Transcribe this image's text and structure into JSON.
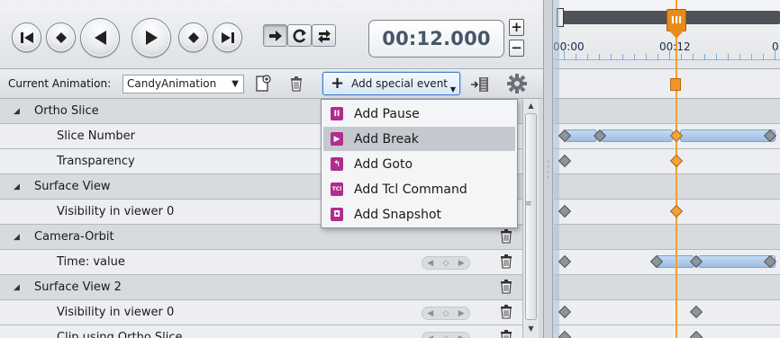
{
  "player": {
    "time_display": "00:12.000",
    "plus_label": "+",
    "minus_label": "−"
  },
  "animation_bar": {
    "current_label": "Current Animation:",
    "current_value": "CandyAnimation",
    "add_special_label": "Add special event"
  },
  "menu": {
    "items": [
      {
        "label": "Add Pause",
        "icon": "pause-event-icon",
        "glyph": "II"
      },
      {
        "label": "Add Break",
        "icon": "break-event-icon",
        "glyph": "▶"
      },
      {
        "label": "Add Goto",
        "icon": "goto-event-icon",
        "glyph": "↰"
      },
      {
        "label": "Add Tcl Command",
        "icon": "tcl-event-icon",
        "glyph": "TCl"
      },
      {
        "label": "Add Snapshot",
        "icon": "snapshot-event-icon",
        "glyph": "◘"
      }
    ],
    "highlighted": "Add Break"
  },
  "tree": {
    "rows": [
      {
        "type": "group",
        "label": "Ortho Slice"
      },
      {
        "type": "item",
        "label": "Slice Number"
      },
      {
        "type": "item",
        "label": "Transparency"
      },
      {
        "type": "group",
        "label": "Surface View"
      },
      {
        "type": "item",
        "label": "Visibility in viewer 0"
      },
      {
        "type": "group",
        "label": "Camera-Orbit"
      },
      {
        "type": "item",
        "label": "Time: value"
      },
      {
        "type": "group",
        "label": "Surface View 2"
      },
      {
        "type": "item",
        "label": "Visibility in viewer 0"
      },
      {
        "type": "item",
        "label": "Clip using Ortho Slice"
      }
    ]
  },
  "timeline": {
    "labels": [
      "00:00",
      "00:12",
      "0"
    ],
    "current_time": "00:12"
  },
  "colors": {
    "accent": "#e98b1a",
    "event_icon": "#b02c8f",
    "segment": "#9dbde2"
  }
}
